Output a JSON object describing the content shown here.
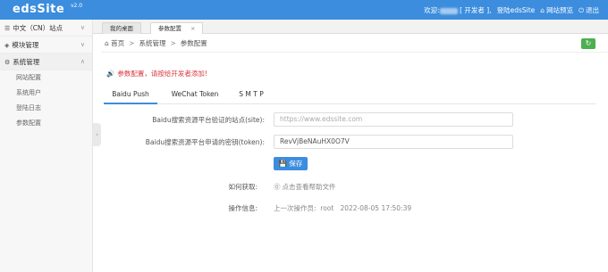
{
  "app": {
    "logo": "edsSite",
    "version": "v2.0"
  },
  "topbar": {
    "welcome_prefix": "欢迎:",
    "role": "[ 开发者 ],",
    "login_text": "登陆edsSite",
    "preview": "网站预览",
    "logout": "退出"
  },
  "sidebar": {
    "items": [
      {
        "label": "中文（CN）站点",
        "chevron": "∨"
      },
      {
        "label": "模块管理",
        "chevron": "∨"
      },
      {
        "label": "系统管理",
        "chevron": "∧"
      }
    ],
    "subitems": [
      "网站配置",
      "系统用户",
      "登陆日志",
      "参数配置"
    ]
  },
  "tabs": [
    {
      "label": "我的桌面"
    },
    {
      "label": "参数配置",
      "close": "×"
    }
  ],
  "breadcrumb": {
    "home": "首页",
    "sep": ">",
    "level1": "系统管理",
    "level2": "参数配置"
  },
  "alert": "参数配置，请按给开发者添加!",
  "content_tabs": [
    "Baidu Push",
    "WeChat Token",
    "S M T P"
  ],
  "form": {
    "site_label": "Baidu搜索资源平台验证的站点(site):",
    "site_placeholder": "https://www.edssite.com",
    "token_label": "Baidu搜索资源平台申请的密钥(token):",
    "token_value": "RevVjBeNAuHX0O7V",
    "save": "保存",
    "howto_label": "如何获取:",
    "howto_link": "点击查看帮助文件",
    "op_label": "操作信息:",
    "op_value": "上一次操作员:  root   2022-08-05 17:50:39"
  }
}
